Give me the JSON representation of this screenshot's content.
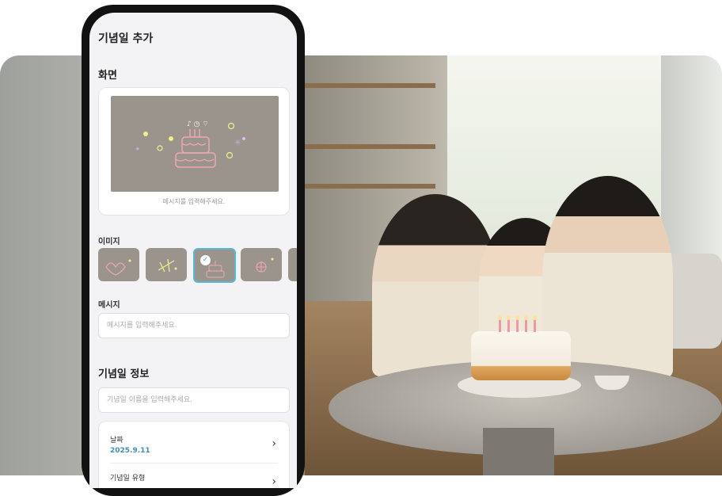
{
  "screen": {
    "title": "기념일 추가",
    "display_section": {
      "title": "화면",
      "preview_hint": "메시지를 입력해주세요."
    },
    "image_label": "이미지",
    "image_options": [
      {
        "icon": "hearts-icon",
        "selected": false
      },
      {
        "icon": "fireworks-icon",
        "selected": false
      },
      {
        "icon": "cake-icon",
        "selected": true
      },
      {
        "icon": "flower-icon",
        "selected": false
      },
      {
        "icon": "more-icon",
        "selected": false
      }
    ],
    "message_label": "메시지",
    "message_placeholder": "메시지를 입력해주세요.",
    "info_section": {
      "title": "기념일 정보",
      "name_placeholder": "기념일 이름을 입력해주세요.",
      "date_label": "날짜",
      "date_value": "2025.9.11",
      "type_label": "기념일 유형"
    }
  },
  "colors": {
    "accent": "#59b8d8",
    "date_text": "#3c8fb0",
    "phone_frame": "#121212"
  }
}
